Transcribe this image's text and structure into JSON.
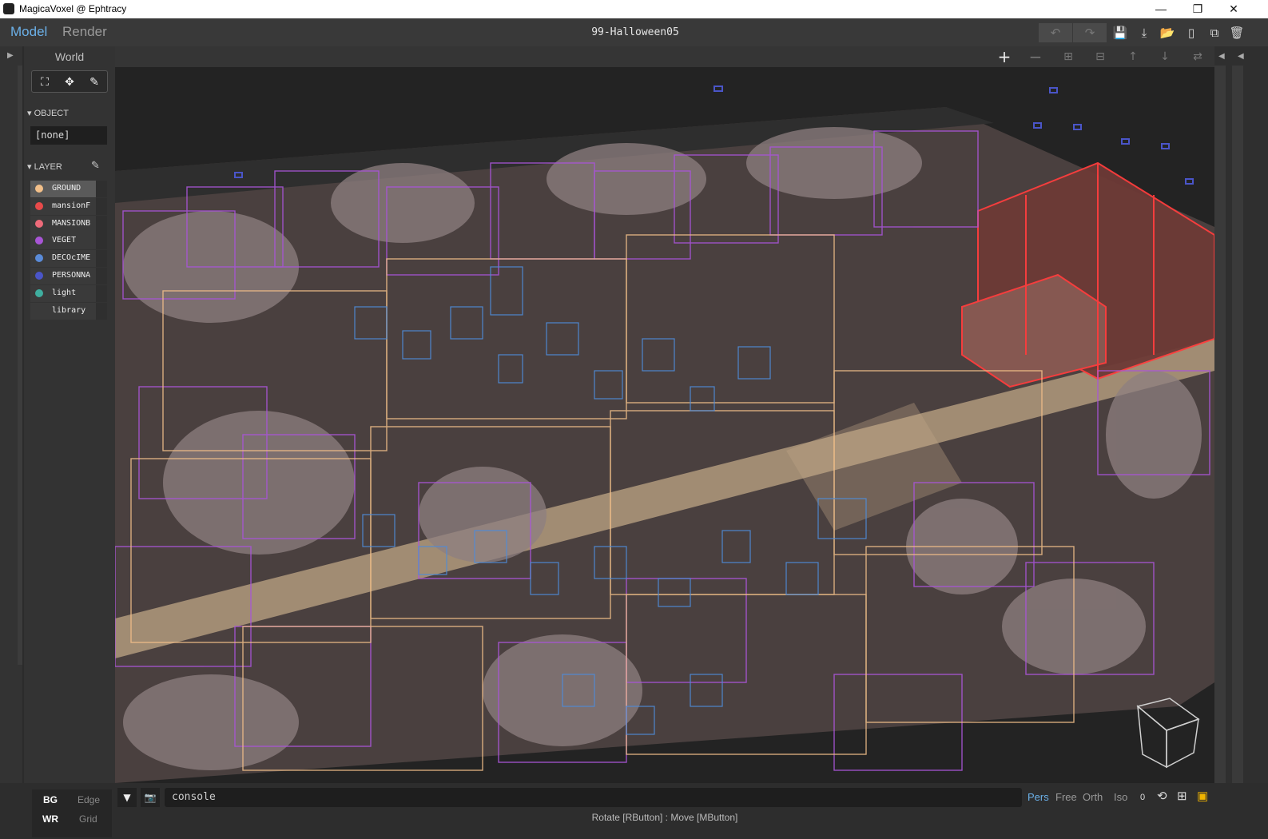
{
  "window": {
    "title": "MagicaVoxel @ Ephtracy",
    "minimize": "—",
    "restore": "❐",
    "close": "✕"
  },
  "modes": {
    "model": "Model",
    "render": "Render"
  },
  "document": {
    "title": "99-Halloween05"
  },
  "toolbar": {
    "undo_icon": "↶",
    "redo_icon": "↷",
    "save_icon": "💾",
    "export_icon": "⤓",
    "open_icon": "📂",
    "new_icon": "▯",
    "duplicate_icon": "⧉",
    "delete_icon": "🗑"
  },
  "sidebar": {
    "world_label": "World",
    "tools": {
      "select_icon": "⛶",
      "move_icon": "✥",
      "brush_icon": "✎"
    },
    "object_section": "▾ OBJECT",
    "object_value": "[none]",
    "layer_section": "▾ LAYER",
    "layer_edit_icon": "✎",
    "layers": [
      {
        "name": "GROUND",
        "color": "#f3c08a",
        "selected": true
      },
      {
        "name": "mansionF",
        "color": "#e84a4a",
        "selected": false
      },
      {
        "name": "MANSIONB",
        "color": "#ee6b7a",
        "selected": false
      },
      {
        "name": "VEGET",
        "color": "#a855d6",
        "selected": false
      },
      {
        "name": "DECOcIME",
        "color": "#5a8bd8",
        "selected": false
      },
      {
        "name": "PERSONNA",
        "color": "#4a55c8",
        "selected": false
      },
      {
        "name": "light",
        "color": "#3fae9f",
        "selected": false
      },
      {
        "name": "library",
        "color": "",
        "selected": false
      }
    ]
  },
  "viewbar": {
    "add_icon": "+",
    "remove_icon": "−",
    "group_icon": "⊞",
    "ungroup_icon": "⊟",
    "up_icon": "↑",
    "down_icon": "↓",
    "swap_icon": "⇄",
    "collapse_icon": "◀"
  },
  "bottom": {
    "bg_label": "BG",
    "edge_label": "Edge",
    "wr_label": "WR",
    "grid_label": "Grid",
    "console_toggle_icon": "▼",
    "camera_icon": "📷",
    "console_text": "console",
    "projection": {
      "pers": "Pers",
      "free": "Free",
      "orth": "Orth",
      "iso": "Iso"
    },
    "zoom_value": "0",
    "reset_icon": "⟲",
    "frame_icon": "⊞",
    "cube_icon": "▣",
    "status_text": "Rotate [RButton] : Move [MButton]"
  },
  "colors": {
    "accent": "#6bb0e8",
    "ground": "#f3c08a",
    "mansion": "#ff4a4a",
    "veget": "#a855d6",
    "deco": "#4f8bd6",
    "personna": "#4a55c8"
  }
}
